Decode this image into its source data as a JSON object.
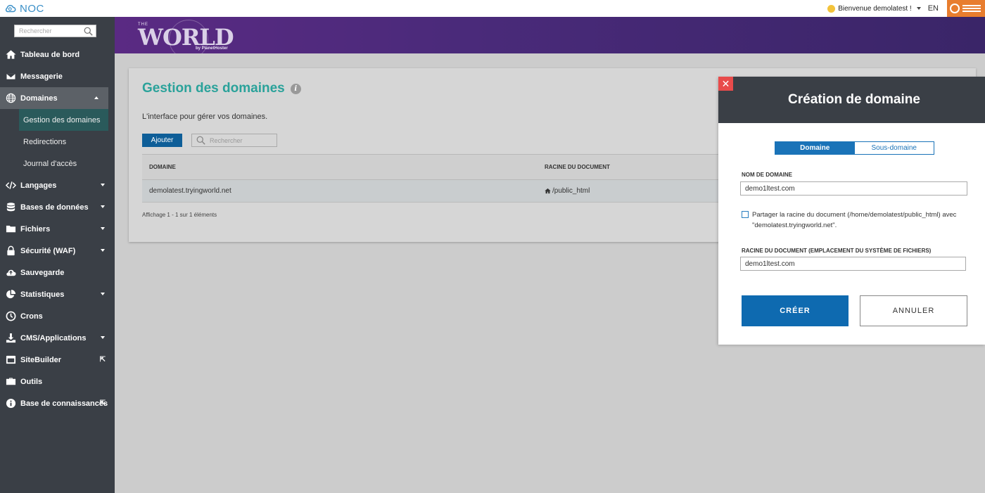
{
  "topbar": {
    "app_name": "NOC",
    "welcome": "Bienvenue demolatest !",
    "language": "EN"
  },
  "sidebar": {
    "search_placeholder": "Rechercher",
    "items": [
      {
        "label": "Tableau de bord",
        "icon": "home-icon"
      },
      {
        "label": "Messagerie",
        "icon": "envelope-icon"
      },
      {
        "label": "Domaines",
        "icon": "globe-icon",
        "expanded": true
      },
      {
        "label": "Langages",
        "icon": "code-icon"
      },
      {
        "label": "Bases de données",
        "icon": "database-icon"
      },
      {
        "label": "Fichiers",
        "icon": "folder-icon"
      },
      {
        "label": "Sécurité (WAF)",
        "icon": "lock-icon"
      },
      {
        "label": "Sauvegarde",
        "icon": "cloud-upload-icon"
      },
      {
        "label": "Statistiques",
        "icon": "pie-chart-icon"
      },
      {
        "label": "Crons",
        "icon": "clock-icon"
      },
      {
        "label": "CMS/Applications",
        "icon": "download-icon"
      },
      {
        "label": "SiteBuilder",
        "icon": "sitebuilder-icon"
      },
      {
        "label": "Outils",
        "icon": "toolbox-icon"
      },
      {
        "label": "Base de connaissances",
        "icon": "info-icon"
      }
    ],
    "subitems": [
      {
        "label": "Gestion des domaines",
        "selected": true
      },
      {
        "label": "Redirections"
      },
      {
        "label": "Journal d'accès"
      }
    ]
  },
  "banner": {
    "the": "THE",
    "world": "WORLD",
    "by": "by PlanetHoster"
  },
  "main": {
    "title": "Gestion des domaines",
    "description": "L'interface pour gérer vos domaines.",
    "add_label": "Ajouter",
    "search_placeholder": "Rechercher",
    "columns": [
      "DOMAINE",
      "RACINE DU DOCUMENT"
    ],
    "rows": [
      {
        "domain": "demolatest.tryingworld.net",
        "root": "/public_html"
      }
    ],
    "footer": "Affichage 1 - 1 sur 1 éléments"
  },
  "modal": {
    "title": "Création de domaine",
    "close": "✕",
    "tab_domain": "Domaine",
    "tab_subdomain": "Sous-domaine",
    "domain_label": "NOM DE DOMAINE",
    "domain_value": "demo1ltest.com",
    "share_text": "Partager la racine du document (/home/demolatest/public_html) avec \"demolatest.tryingworld.net\".",
    "share_checked": false,
    "root_label": "RACINE DU DOCUMENT (EMPLACEMENT DU SYSTÈME DE FICHIERS)",
    "root_value": "demo1ltest.com",
    "create_label": "CRÉER",
    "cancel_label": "ANNULER"
  },
  "colors": {
    "accent": "#1a73b8",
    "title_teal": "#2aa29a",
    "sidebar_bg": "#3a3f46",
    "close_red": "#e84b4b"
  }
}
